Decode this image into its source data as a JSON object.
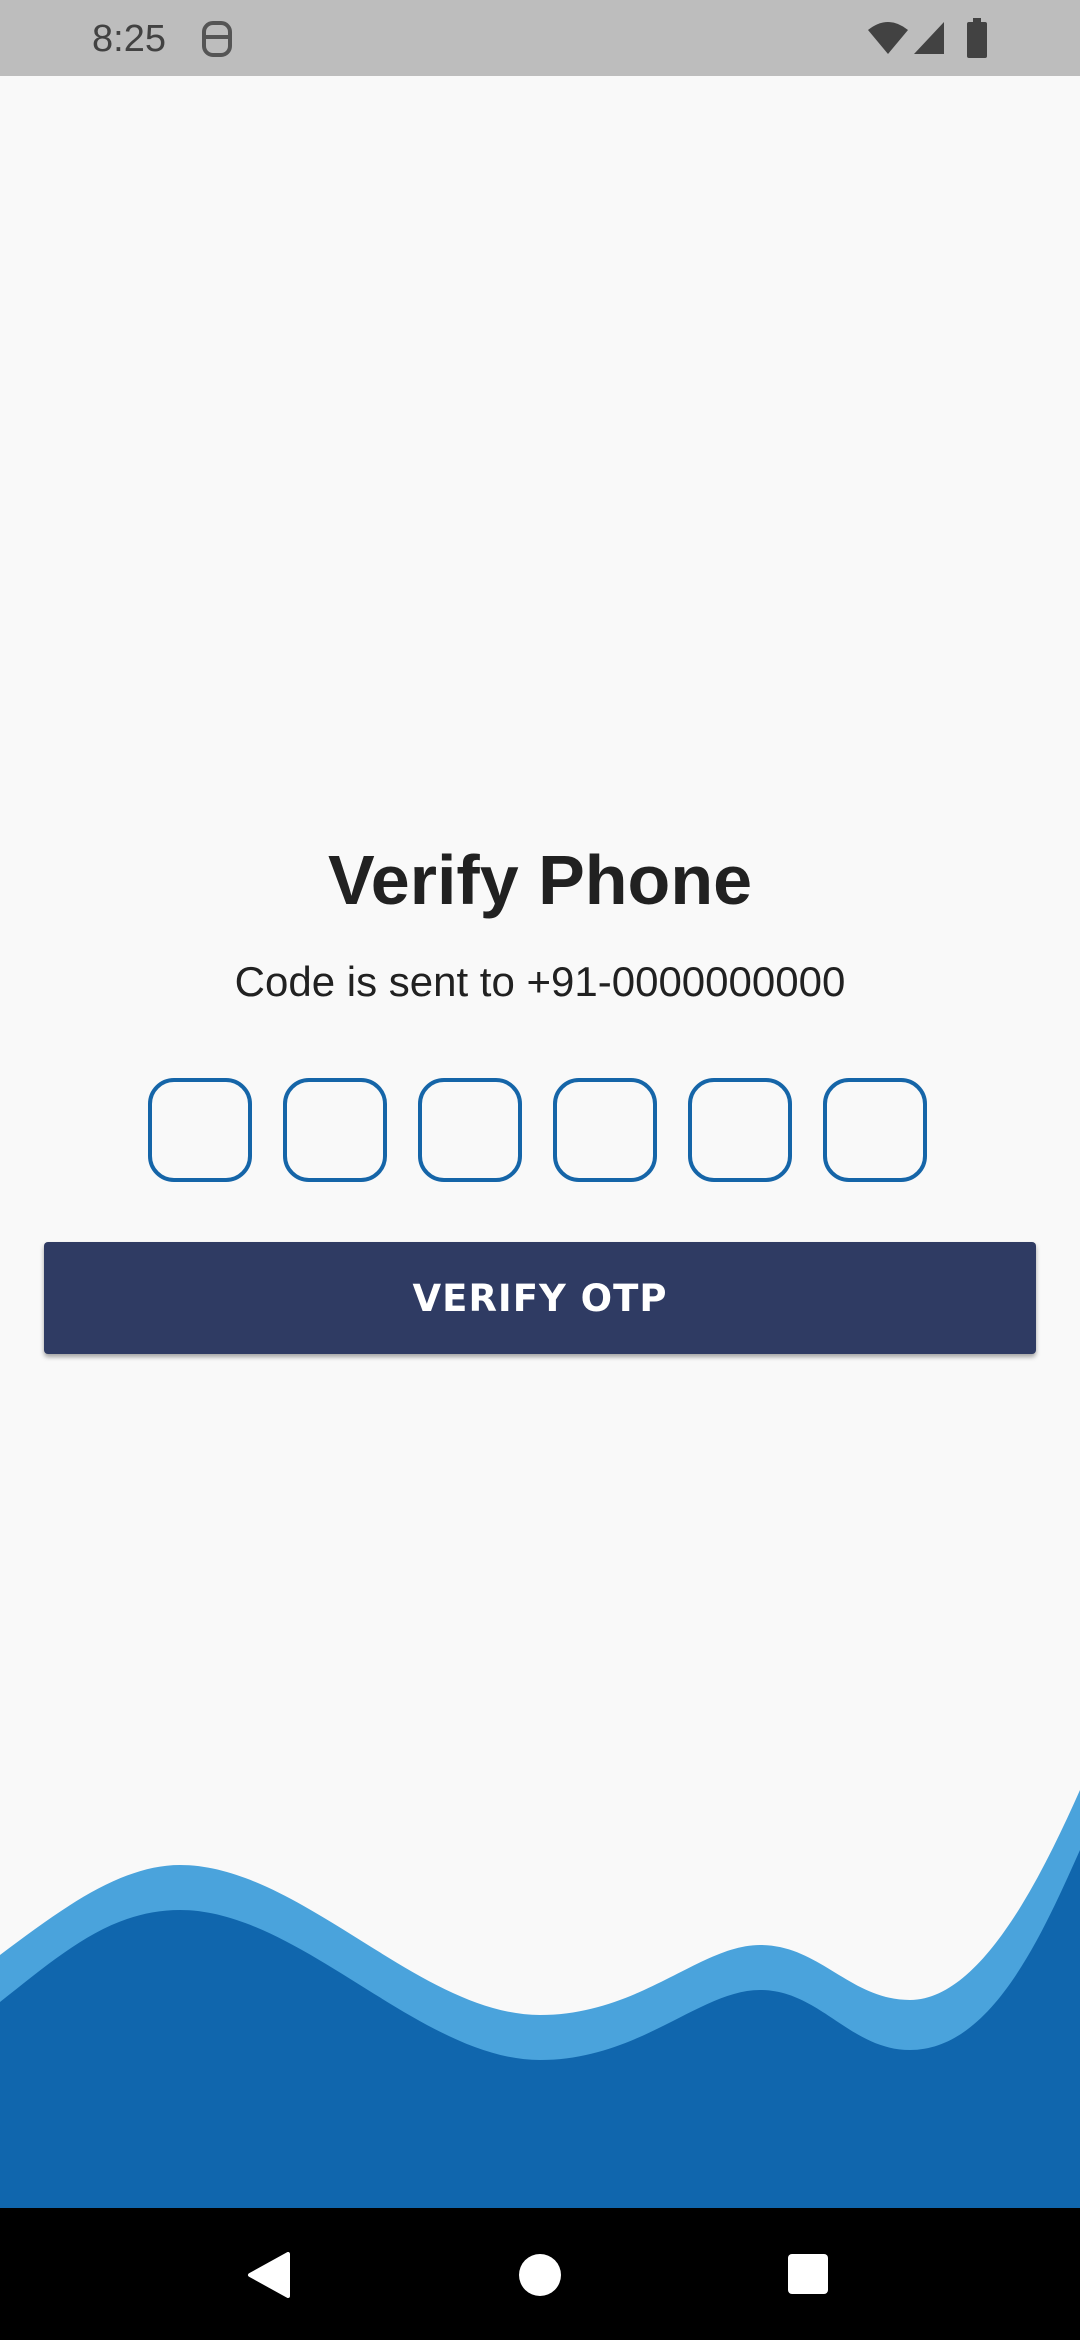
{
  "status_bar": {
    "time": "8:25",
    "icons": [
      "notification-icon",
      "wifi-icon",
      "signal-icon",
      "battery-icon"
    ]
  },
  "screen": {
    "title": "Verify Phone",
    "subtitle": "Code is sent to +91-0000000000",
    "otp_digits": [
      "",
      "",
      "",
      "",
      "",
      ""
    ],
    "verify_button": "VERIFY OTP"
  },
  "colors": {
    "background": "#f9f9f9",
    "status_bar": "#bdbdbd",
    "otp_border": "#1565a8",
    "button": "#2f3b63",
    "wave_light": "#4aa3dc",
    "wave_dark": "#1066ad"
  },
  "nav_bar": {
    "icons": [
      "back-icon",
      "home-icon",
      "recents-icon"
    ]
  }
}
